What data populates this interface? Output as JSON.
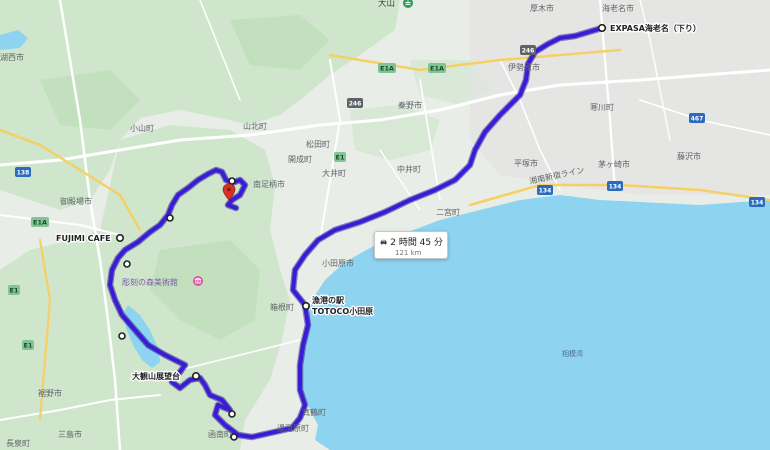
{
  "map": {
    "places": {
      "oyama": "大山",
      "atsugi": "厚木市",
      "ebina": "海老名市",
      "isehara": "伊勢原市",
      "hadano": "秦野市",
      "samukawa": "寒川町",
      "kaisei": "開成町",
      "matsuda": "松田町",
      "oi": "大井町",
      "nakai": "中井町",
      "hiratsuka": "平塚市",
      "chigasaki": "茅ヶ崎市",
      "fujisawa": "藤沢市",
      "ninomiya": "二宮町",
      "minamiashigara": "南足柄市",
      "yamakita": "山北町",
      "oyama_cho": "小山町",
      "gotemba": "御殿場市",
      "odawara": "小田原市",
      "hakone": "箱根町",
      "manazuru": "真鶴町",
      "yugawara": "湯河原町",
      "susono": "裾野市",
      "nagaizumi": "長泉町",
      "mishima": "三島市",
      "kannami": "函南町",
      "kosai": "湖西市",
      "shonan_line": "湘南新宿ライン",
      "sagami_bay": "相模湾",
      "museum": "彫刻の森美術館"
    },
    "pois": {
      "expasa": "EXPASA海老名（下り）",
      "fujimi": "FUJIMI CAFE",
      "totoco_line1": "漁港の駅",
      "totoco_line2": "TOTOCO小田原",
      "daikanzan": "大観山展望台"
    },
    "route_labels": {
      "r246": "246",
      "e1a_a": "E1A",
      "e1a_b": "E1A",
      "e1a_c": "E1A",
      "e1": "E1",
      "e1_b": "E1",
      "e1_c": "E1",
      "r134_a": "134",
      "r134_b": "134",
      "r134_c": "134",
      "r138": "138",
      "r467": "467",
      "r246_b": "246"
    },
    "route_info": {
      "duration": "2 時間 45 分",
      "distance": "121 km"
    },
    "colors": {
      "route": "#3b1cd6",
      "sea": "#8ed3ef",
      "land": "#e9ede8",
      "forest": "#cfe6cc",
      "road": "#ffffff",
      "marker": "#d93025"
    },
    "icons": {
      "car": "car-icon",
      "pin": "map-pin-icon",
      "museum": "museum-icon",
      "temple": "temple-icon"
    }
  }
}
